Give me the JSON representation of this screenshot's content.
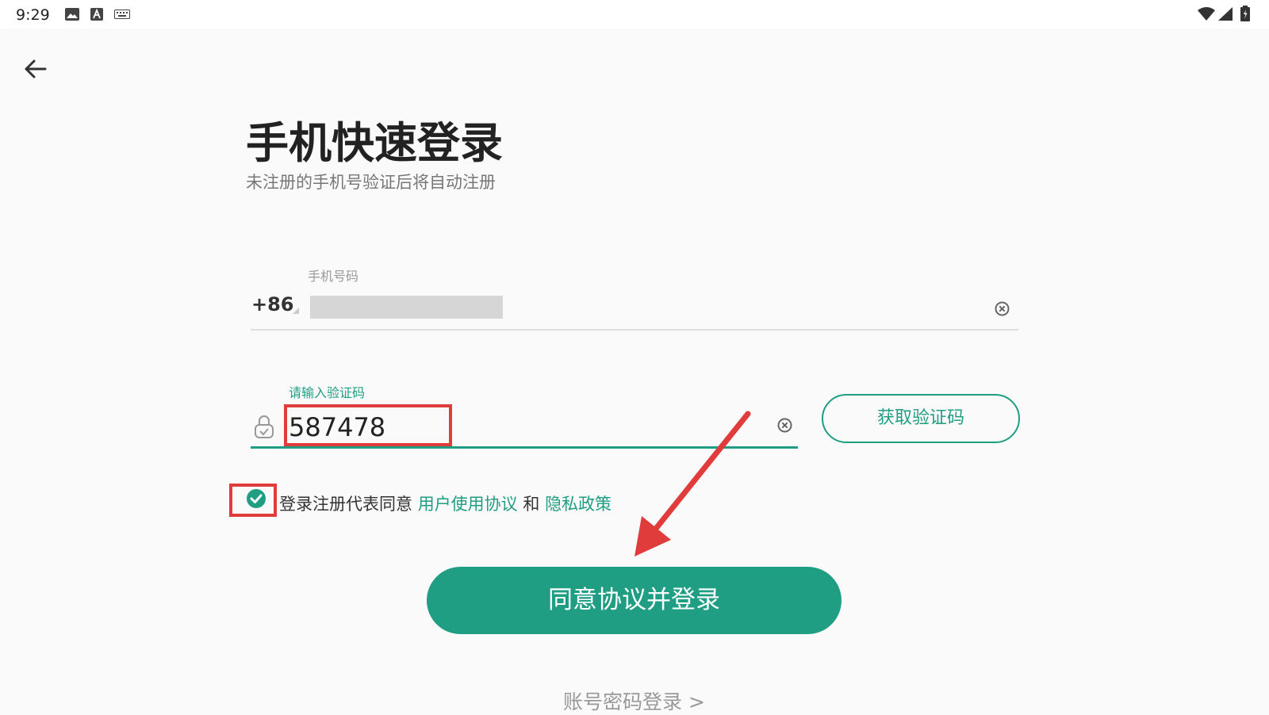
{
  "status_bar": {
    "time": "9:29",
    "icons": [
      "image-icon",
      "a-badge-icon",
      "keyboard-icon",
      "wifi-icon",
      "signal-icon",
      "battery-icon"
    ]
  },
  "header": {
    "back_icon": "back-arrow-icon"
  },
  "title": "手机快速登录",
  "subtitle": "未注册的手机号验证后将自动注册",
  "phone": {
    "label": "手机号码",
    "country_code": "+86"
  },
  "code": {
    "label": "请输入验证码",
    "value": "587478",
    "get_code_label": "获取验证码"
  },
  "agreement": {
    "prefix": "登录注册代表同意",
    "terms_link": "用户使用协议",
    "and": "和",
    "privacy_link": "隐私政策",
    "checked": true
  },
  "login_button": "同意协议并登录",
  "password_login": "账号密码登录 >",
  "colors": {
    "accent": "#1f9e84",
    "annotation": "#e03c3c"
  }
}
